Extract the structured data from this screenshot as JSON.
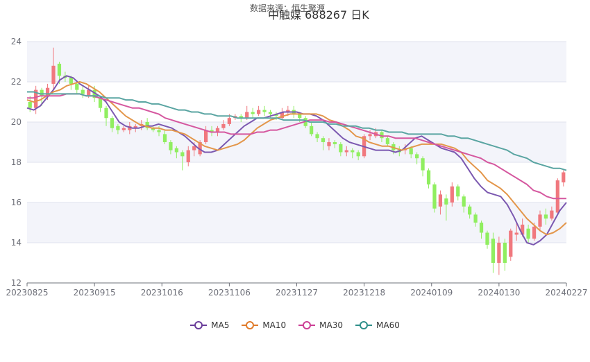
{
  "header": {
    "source_text": "数据来源：恒生聚源",
    "title": "中触媒 688267      日K"
  },
  "chart_data": {
    "type": "candlestick",
    "title": "中触媒 688267      日K",
    "xlabel": "",
    "ylabel": "",
    "ylim": [
      12,
      24
    ],
    "yticks": [
      12,
      14,
      16,
      18,
      20,
      22,
      24
    ],
    "xtick_labels": [
      "20230825",
      "20230915",
      "20231016",
      "20231106",
      "20231127",
      "20231218",
      "20240109",
      "20240130",
      "20240227"
    ],
    "grid": true,
    "legend_position": "bottom",
    "colors": {
      "up": "#f0787e",
      "down": "#90ee60",
      "band": "#f3f4fa",
      "grid": "#dfe2ee",
      "axis": "#6e7079"
    },
    "series": [
      {
        "name": "MA5",
        "color": "#7b58b0",
        "values": [
          20.7,
          20.6,
          20.8,
          21.2,
          21.6,
          22.1,
          22.3,
          22.2,
          21.9,
          21.7,
          21.5,
          21.3,
          21.0,
          20.5,
          20.0,
          19.8,
          19.7,
          19.7,
          19.8,
          19.8,
          19.9,
          19.8,
          19.7,
          19.5,
          19.3,
          19.0,
          18.7,
          18.5,
          18.5,
          18.6,
          18.9,
          19.2,
          19.5,
          19.8,
          20.0,
          20.2,
          20.2,
          20.3,
          20.4,
          20.5,
          20.5,
          20.5,
          20.4,
          20.4,
          20.3,
          20.1,
          19.8,
          19.5,
          19.2,
          19.0,
          18.9,
          18.8,
          18.7,
          18.6,
          18.6,
          18.6,
          18.5,
          18.6,
          18.9,
          19.2,
          19.3,
          19.1,
          18.9,
          18.7,
          18.6,
          18.5,
          18.2,
          17.7,
          17.2,
          16.8,
          16.5,
          16.4,
          16.3,
          15.9,
          15.3,
          14.6,
          14.0,
          13.9,
          14.1,
          14.4,
          15.0,
          15.6,
          16.0
        ]
      },
      {
        "name": "MA10",
        "color": "#e3964a",
        "values": [
          21.1,
          21.0,
          21.1,
          21.3,
          21.5,
          21.6,
          21.8,
          21.9,
          22.0,
          21.9,
          21.7,
          21.5,
          21.2,
          20.9,
          20.6,
          20.3,
          20.1,
          19.9,
          19.8,
          19.7,
          19.7,
          19.6,
          19.6,
          19.5,
          19.4,
          19.2,
          19.0,
          18.8,
          18.7,
          18.6,
          18.7,
          18.8,
          18.9,
          19.1,
          19.4,
          19.7,
          19.9,
          20.1,
          20.2,
          20.3,
          20.4,
          20.4,
          20.4,
          20.4,
          20.4,
          20.3,
          20.1,
          20.0,
          19.8,
          19.6,
          19.3,
          19.2,
          19.0,
          18.9,
          18.8,
          18.8,
          18.7,
          18.6,
          18.7,
          18.8,
          18.9,
          18.9,
          18.9,
          18.9,
          18.8,
          18.7,
          18.5,
          18.1,
          17.8,
          17.5,
          17.1,
          16.9,
          16.7,
          16.4,
          16.0,
          15.6,
          15.2,
          14.9,
          14.6,
          14.4,
          14.5,
          14.7,
          15.0
        ]
      },
      {
        "name": "MA30",
        "color": "#d5579f",
        "values": [
          21.2,
          21.2,
          21.3,
          21.3,
          21.3,
          21.3,
          21.4,
          21.4,
          21.4,
          21.3,
          21.3,
          21.2,
          21.1,
          21.0,
          20.9,
          20.8,
          20.7,
          20.7,
          20.6,
          20.5,
          20.4,
          20.2,
          20.1,
          20.0,
          19.9,
          19.8,
          19.7,
          19.6,
          19.5,
          19.5,
          19.5,
          19.4,
          19.4,
          19.4,
          19.4,
          19.5,
          19.5,
          19.6,
          19.6,
          19.7,
          19.8,
          19.9,
          20.0,
          20.1,
          20.1,
          20.1,
          20.0,
          20.0,
          19.9,
          19.8,
          19.7,
          19.6,
          19.5,
          19.4,
          19.3,
          19.3,
          19.2,
          19.2,
          19.2,
          19.2,
          19.1,
          19.0,
          18.9,
          18.8,
          18.7,
          18.6,
          18.5,
          18.4,
          18.3,
          18.2,
          18.0,
          17.9,
          17.7,
          17.5,
          17.3,
          17.1,
          16.9,
          16.6,
          16.5,
          16.3,
          16.2,
          16.2,
          16.2
        ]
      },
      {
        "name": "MA60",
        "color": "#5aa5a2",
        "values": [
          21.5,
          21.5,
          21.4,
          21.4,
          21.4,
          21.4,
          21.4,
          21.4,
          21.4,
          21.3,
          21.3,
          21.3,
          21.2,
          21.2,
          21.2,
          21.1,
          21.1,
          21.0,
          21.0,
          20.9,
          20.9,
          20.8,
          20.7,
          20.6,
          20.6,
          20.5,
          20.5,
          20.4,
          20.4,
          20.3,
          20.3,
          20.3,
          20.2,
          20.2,
          20.2,
          20.2,
          20.2,
          20.2,
          20.2,
          20.1,
          20.1,
          20.1,
          20.1,
          20.0,
          20.0,
          20.0,
          19.9,
          19.9,
          19.8,
          19.8,
          19.8,
          19.7,
          19.7,
          19.6,
          19.6,
          19.5,
          19.5,
          19.5,
          19.4,
          19.4,
          19.4,
          19.4,
          19.4,
          19.4,
          19.3,
          19.3,
          19.2,
          19.2,
          19.1,
          19.0,
          18.9,
          18.8,
          18.7,
          18.6,
          18.4,
          18.3,
          18.2,
          18.0,
          17.9,
          17.8,
          17.7,
          17.7,
          17.6
        ]
      }
    ],
    "candles": [
      {
        "date": "20230825",
        "open": 21.0,
        "close": 20.7,
        "high": 21.3,
        "low": 20.5
      },
      {
        "o": 20.7,
        "c": 21.6,
        "h": 21.8,
        "l": 20.4
      },
      {
        "o": 21.6,
        "c": 21.3,
        "h": 21.7,
        "l": 20.8
      },
      {
        "o": 21.3,
        "c": 21.7,
        "h": 21.9,
        "l": 21.1
      },
      {
        "o": 21.9,
        "c": 22.8,
        "h": 23.7,
        "l": 21.6
      },
      {
        "o": 22.9,
        "c": 22.3,
        "h": 23.0,
        "l": 21.9
      },
      {
        "o": 22.3,
        "c": 22.2,
        "h": 22.5,
        "l": 22.0
      },
      {
        "o": 22.2,
        "c": 21.9,
        "h": 22.3,
        "l": 21.6
      },
      {
        "o": 21.9,
        "c": 21.6,
        "h": 22.0,
        "l": 21.4
      },
      {
        "o": 21.6,
        "c": 21.4,
        "h": 21.8,
        "l": 21.2
      },
      {
        "o": 21.3,
        "c": 21.6,
        "h": 21.8,
        "l": 21.2
      },
      {
        "o": 21.6,
        "c": 21.2,
        "h": 21.8,
        "l": 21.0
      },
      {
        "o": 21.2,
        "c": 20.7,
        "h": 21.3,
        "l": 20.5
      },
      {
        "o": 20.7,
        "c": 20.2,
        "h": 20.8,
        "l": 19.8
      },
      {
        "o": 20.2,
        "c": 19.7,
        "h": 20.3,
        "l": 19.5
      },
      {
        "o": 19.8,
        "c": 19.6,
        "h": 19.9,
        "l": 19.4
      },
      {
        "o": 19.6,
        "c": 19.7,
        "h": 19.8,
        "l": 19.5
      },
      {
        "o": 19.6,
        "c": 19.8,
        "h": 20.0,
        "l": 19.4
      },
      {
        "o": 19.7,
        "c": 19.8,
        "h": 19.9,
        "l": 19.5
      },
      {
        "date": "20230915",
        "open": 19.8,
        "close": 19.9,
        "high": 20.1,
        "low": 19.6
      },
      {
        "o": 20.0,
        "c": 19.7,
        "h": 20.2,
        "l": 19.6
      },
      {
        "o": 19.7,
        "c": 19.6,
        "h": 19.8,
        "l": 19.5
      },
      {
        "o": 19.6,
        "c": 19.5,
        "h": 19.8,
        "l": 19.3
      },
      {
        "o": 19.4,
        "c": 19.0,
        "h": 19.6,
        "l": 18.9
      },
      {
        "o": 19.0,
        "c": 18.6,
        "h": 19.1,
        "l": 18.4
      },
      {
        "o": 18.7,
        "c": 18.5,
        "h": 18.8,
        "l": 18.2
      },
      {
        "o": 18.5,
        "c": 18.3,
        "h": 18.6,
        "l": 17.6
      },
      {
        "o": 18.0,
        "c": 18.6,
        "h": 18.8,
        "l": 17.8
      },
      {
        "o": 18.6,
        "c": 18.8,
        "h": 19.0,
        "l": 18.3
      },
      {
        "o": 18.4,
        "c": 19.0,
        "h": 19.1,
        "l": 18.3
      },
      {
        "o": 19.0,
        "c": 19.6,
        "h": 19.8,
        "l": 18.9
      },
      {
        "o": 19.6,
        "c": 19.5,
        "h": 19.8,
        "l": 19.3
      },
      {
        "date": "20231016",
        "open": 19.5,
        "close": 19.7,
        "high": 19.8,
        "low": 19.3
      },
      {
        "o": 19.7,
        "c": 19.9,
        "h": 20.1,
        "l": 19.6
      },
      {
        "o": 19.9,
        "c": 20.2,
        "h": 20.4,
        "l": 19.8
      },
      {
        "o": 20.2,
        "c": 20.3,
        "h": 20.4,
        "l": 20.1
      },
      {
        "o": 20.3,
        "c": 20.2,
        "h": 20.4,
        "l": 20.0
      },
      {
        "o": 20.2,
        "c": 20.5,
        "h": 20.8,
        "l": 20.1
      },
      {
        "o": 20.5,
        "c": 20.4,
        "h": 20.7,
        "l": 20.2
      },
      {
        "o": 20.4,
        "c": 20.6,
        "h": 20.8,
        "l": 20.3
      },
      {
        "o": 20.6,
        "c": 20.5,
        "h": 20.8,
        "l": 20.3
      },
      {
        "o": 20.5,
        "c": 20.4,
        "h": 20.6,
        "l": 20.2
      },
      {
        "o": 20.4,
        "c": 20.3,
        "h": 20.5,
        "l": 20.1
      },
      {
        "o": 20.2,
        "c": 20.5,
        "h": 20.7,
        "l": 20.1
      },
      {
        "o": 20.5,
        "c": 20.6,
        "h": 20.8,
        "l": 20.3
      },
      {
        "date": "20231106",
        "open": 20.6,
        "close": 20.4,
        "high": 20.8,
        "low": 20.2
      },
      {
        "o": 20.4,
        "c": 20.2,
        "h": 20.5,
        "l": 20.0
      },
      {
        "o": 20.2,
        "c": 19.8,
        "h": 20.3,
        "l": 19.7
      },
      {
        "o": 19.8,
        "c": 19.4,
        "h": 20.0,
        "l": 19.3
      },
      {
        "o": 19.4,
        "c": 19.2,
        "h": 19.5,
        "l": 19.0
      },
      {
        "o": 19.2,
        "c": 19.0,
        "h": 19.3,
        "l": 18.6
      },
      {
        "o": 18.8,
        "c": 19.0,
        "h": 19.2,
        "l": 18.6
      },
      {
        "o": 19.0,
        "c": 18.9,
        "h": 19.1,
        "l": 18.7
      },
      {
        "o": 18.9,
        "c": 18.5,
        "h": 19.0,
        "l": 18.3
      },
      {
        "o": 18.5,
        "c": 18.6,
        "h": 18.8,
        "l": 18.3
      },
      {
        "o": 18.6,
        "c": 18.5,
        "h": 18.7,
        "l": 18.2
      },
      {
        "o": 18.5,
        "c": 18.3,
        "h": 18.6,
        "l": 18.1
      },
      {
        "o": 18.3,
        "c": 19.3,
        "h": 19.4,
        "l": 18.2
      },
      {
        "date": "20231127",
        "open": 19.3,
        "close": 19.4,
        "high": 19.6,
        "low": 19.1
      },
      {
        "o": 19.3,
        "c": 19.5,
        "h": 19.7,
        "l": 19.2
      },
      {
        "o": 19.5,
        "c": 19.2,
        "h": 19.6,
        "l": 19.0
      },
      {
        "o": 19.2,
        "c": 18.9,
        "h": 19.3,
        "l": 18.8
      },
      {
        "o": 18.9,
        "c": 18.6,
        "h": 19.0,
        "l": 18.4
      },
      {
        "o": 18.6,
        "c": 18.5,
        "h": 18.8,
        "l": 18.3
      },
      {
        "o": 18.6,
        "c": 18.7,
        "h": 18.9,
        "l": 18.4
      },
      {
        "o": 18.7,
        "c": 18.4,
        "h": 18.8,
        "l": 18.2
      },
      {
        "o": 18.4,
        "c": 18.2,
        "h": 18.5,
        "l": 17.9
      },
      {
        "o": 18.2,
        "c": 17.6,
        "h": 18.3,
        "l": 17.3
      },
      {
        "date": "20231218",
        "open": 17.6,
        "close": 16.9,
        "high": 17.7,
        "low": 16.7
      },
      {
        "o": 16.9,
        "c": 15.7,
        "h": 17.0,
        "l": 15.5
      },
      {
        "o": 15.8,
        "c": 16.4,
        "h": 16.6,
        "l": 15.4
      },
      {
        "o": 16.2,
        "c": 15.9,
        "h": 16.4,
        "l": 15.1
      },
      {
        "o": 16.0,
        "c": 16.8,
        "h": 17.0,
        "l": 15.8
      },
      {
        "o": 16.8,
        "c": 16.3,
        "h": 16.9,
        "l": 16.1
      },
      {
        "o": 16.3,
        "c": 15.8,
        "h": 16.4,
        "l": 15.5
      },
      {
        "o": 15.8,
        "c": 15.4,
        "h": 15.9,
        "l": 15.2
      },
      {
        "o": 15.4,
        "c": 15.0,
        "h": 15.5,
        "l": 14.8
      },
      {
        "date": "20240109",
        "open": 15.0,
        "close": 14.5,
        "high": 15.1,
        "low": 14.2
      },
      {
        "o": 14.5,
        "c": 13.9,
        "h": 14.6,
        "l": 13.7
      },
      {
        "o": 14.2,
        "c": 13.0,
        "h": 14.5,
        "l": 12.5
      },
      {
        "o": 13.0,
        "c": 14.0,
        "h": 14.3,
        "l": 12.4
      },
      {
        "o": 14.0,
        "c": 13.0,
        "h": 14.2,
        "l": 12.6
      },
      {
        "o": 13.3,
        "c": 14.6,
        "h": 14.7,
        "l": 13.1
      },
      {
        "o": 14.4,
        "c": 14.5,
        "h": 15.0,
        "l": 14.1
      },
      {
        "o": 14.4,
        "c": 14.9,
        "h": 15.2,
        "l": 14.3
      },
      {
        "o": 14.7,
        "c": 14.2,
        "h": 14.9,
        "l": 14.0
      },
      {
        "o": 14.2,
        "c": 14.8,
        "h": 15.0,
        "l": 14.1
      },
      {
        "date": "20240130",
        "open": 14.8,
        "close": 15.4,
        "high": 15.6,
        "low": 14.6
      },
      {
        "o": 15.4,
        "c": 15.2,
        "h": 15.7,
        "l": 14.9
      },
      {
        "o": 15.2,
        "c": 15.6,
        "h": 15.8,
        "l": 15.1
      },
      {
        "o": 15.5,
        "c": 17.1,
        "h": 17.2,
        "l": 15.4
      },
      {
        "date": "20240227",
        "open": 17.0,
        "close": 17.5,
        "high": 17.6,
        "low": 16.8
      }
    ]
  },
  "legend": {
    "items": [
      {
        "label": "MA5",
        "color": "#6a3d9a"
      },
      {
        "label": "MA10",
        "color": "#e07b2a"
      },
      {
        "label": "MA30",
        "color": "#cc3f95"
      },
      {
        "label": "MA60",
        "color": "#2f8f8a"
      }
    ]
  }
}
